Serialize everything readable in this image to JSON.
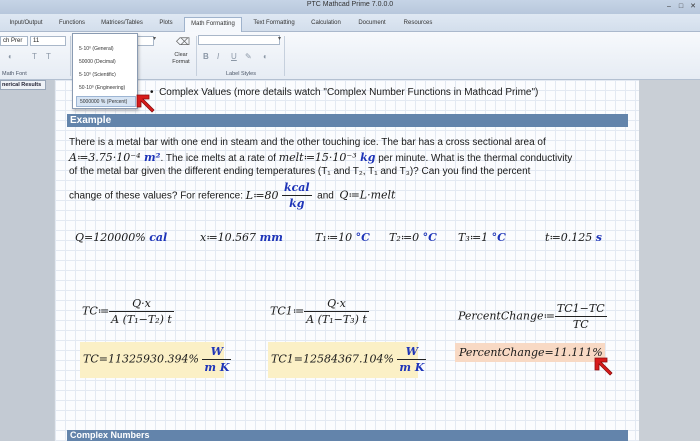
{
  "window": {
    "title": "PTC Mathcad Prime 7.0.0.0"
  },
  "tabs": [
    {
      "label": "Input/Output"
    },
    {
      "label": "Functions"
    },
    {
      "label": "Matrices/Tables"
    },
    {
      "label": "Plots"
    },
    {
      "label": "Math Formatting"
    },
    {
      "label": "Text Formatting"
    },
    {
      "label": "Calculation"
    },
    {
      "label": "Document"
    },
    {
      "label": "Resources"
    }
  ],
  "ribbon": {
    "font_name": "ch Prer",
    "font_size": "11",
    "number_format_value": "50·10⁰ (Engineering)",
    "clear_format_label": "Clear\nFormat",
    "math_font_group": "Math Font",
    "label_styles_group": "Label Styles",
    "bold": "B",
    "italic": "I",
    "underline": "U"
  },
  "dropdown": {
    "items": [
      {
        "label": "5·10⁰ (General)"
      },
      {
        "label": "50000 (Decimal)"
      },
      {
        "label": "5·10⁰ (Scientific)"
      },
      {
        "label": "50·10⁰ (Engineering)"
      },
      {
        "label": "5000000 % (Percent)"
      }
    ],
    "selected_index": 4
  },
  "left_pane": {
    "tab_label": "nerical Results"
  },
  "worksheet": {
    "top_line": "Complex Values (more details watch \"Complex Number Functions in Mathcad Prime\")",
    "section_example": "Example",
    "para_line1": "There is a metal bar with one end in steam and the other touching ice.  The bar has a cross sectional area of",
    "area_expr": "A≔3.75·10⁻⁴ ",
    "area_unit": "m²",
    "para_line2_a": ".  The ice melts at a rate of ",
    "melt_expr": "melt≔15·10⁻³ ",
    "melt_unit": "kg",
    "para_line2_b": " per minute.  What is the thermal conductivity",
    "para_line3": "of the metal bar given the different ending temperatures (T₁ and T₂, T₁ and T₃)?  Can you find the percent",
    "para_line4_a": "change of these values?  For reference: ",
    "ref_L": "L≔80 ",
    "ref_L_num": "kcal",
    "ref_L_den": "kg",
    "para_line4_and": "and",
    "ref_Q": "Q≔L·melt",
    "results": [
      {
        "expr": "Q=120000% ",
        "unit": "cal"
      },
      {
        "expr": "x≔10.567 ",
        "unit": "mm"
      },
      {
        "expr": "T₁≔10 ",
        "unit": "°C"
      },
      {
        "expr": "T₂≔0 ",
        "unit": "°C"
      },
      {
        "expr": "T₃≔1 ",
        "unit": "°C"
      },
      {
        "expr": "t≔0.125 ",
        "unit": "s"
      }
    ],
    "tc_def": {
      "lhs": "TC≔",
      "num": "Q·x",
      "den": "A (T₁−T₂) t"
    },
    "tc1_def": {
      "lhs": "TC1≔",
      "num": "Q·x",
      "den": "A (T₁−T₃) t"
    },
    "pc_def": {
      "lhs": "PercentChange≔",
      "num": "TC1−TC",
      "den": "TC"
    },
    "tc_res": {
      "lhs": "TC=11325930.394% ",
      "num": "W",
      "den": "m K"
    },
    "tc1_res": {
      "lhs": "TC1=12584367.104% ",
      "num": "W",
      "den": "m K"
    },
    "pc_res": "PercentChange=11.111%",
    "section_complex": "Complex Numbers"
  },
  "colors": {
    "section_bar": "#6384ab",
    "unit_blue": "#1e34b8",
    "highlight_yellow": "#fbf0c6",
    "highlight_peach": "#f8d9c4",
    "annotation_arrow": "#d81b1b"
  }
}
